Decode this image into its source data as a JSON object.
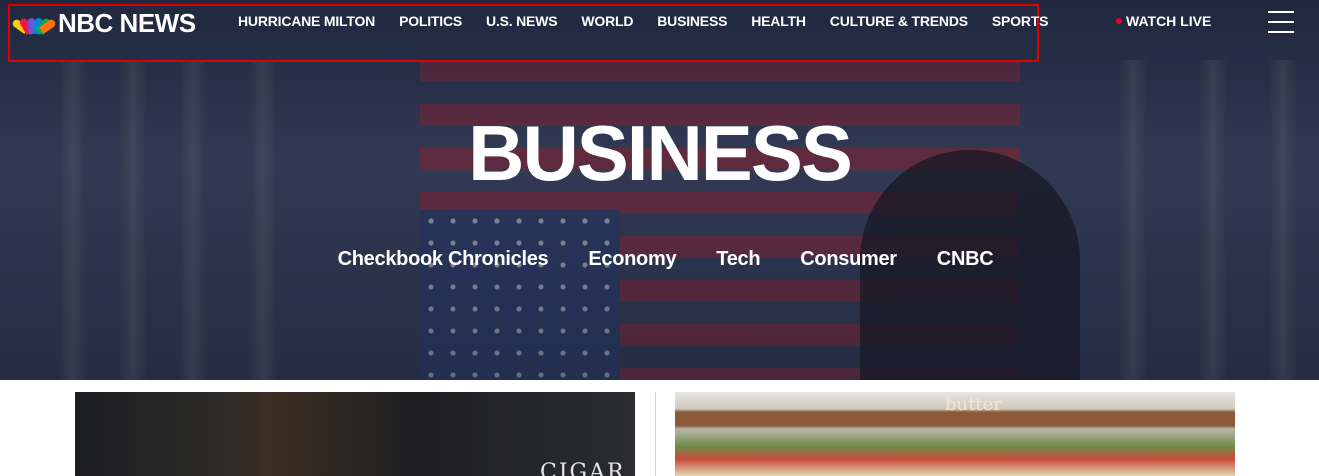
{
  "logo": {
    "text": "NBC NEWS",
    "icon": "peacock-icon"
  },
  "nav": {
    "items": [
      {
        "label": "HURRICANE MILTON"
      },
      {
        "label": "POLITICS"
      },
      {
        "label": "U.S. NEWS"
      },
      {
        "label": "WORLD"
      },
      {
        "label": "BUSINESS"
      },
      {
        "label": "HEALTH"
      },
      {
        "label": "CULTURE & TRENDS"
      },
      {
        "label": "SPORTS"
      }
    ],
    "watch_live": "WATCH LIVE",
    "menu_icon": "hamburger-menu-icon"
  },
  "hero": {
    "title": "BUSINESS",
    "subnav": [
      {
        "label": "Checkbook Chronicles"
      },
      {
        "label": "Economy"
      },
      {
        "label": "Tech"
      },
      {
        "label": "Consumer"
      },
      {
        "label": "CNBC"
      }
    ]
  },
  "cards": {
    "card1": {
      "sign_text": "CIGAR"
    },
    "card2": {
      "shelf_label": "butter"
    }
  },
  "colors": {
    "accent_live": "#e4002b",
    "highlight_frame": "#e00000",
    "hero_overlay": "#2a3450"
  }
}
